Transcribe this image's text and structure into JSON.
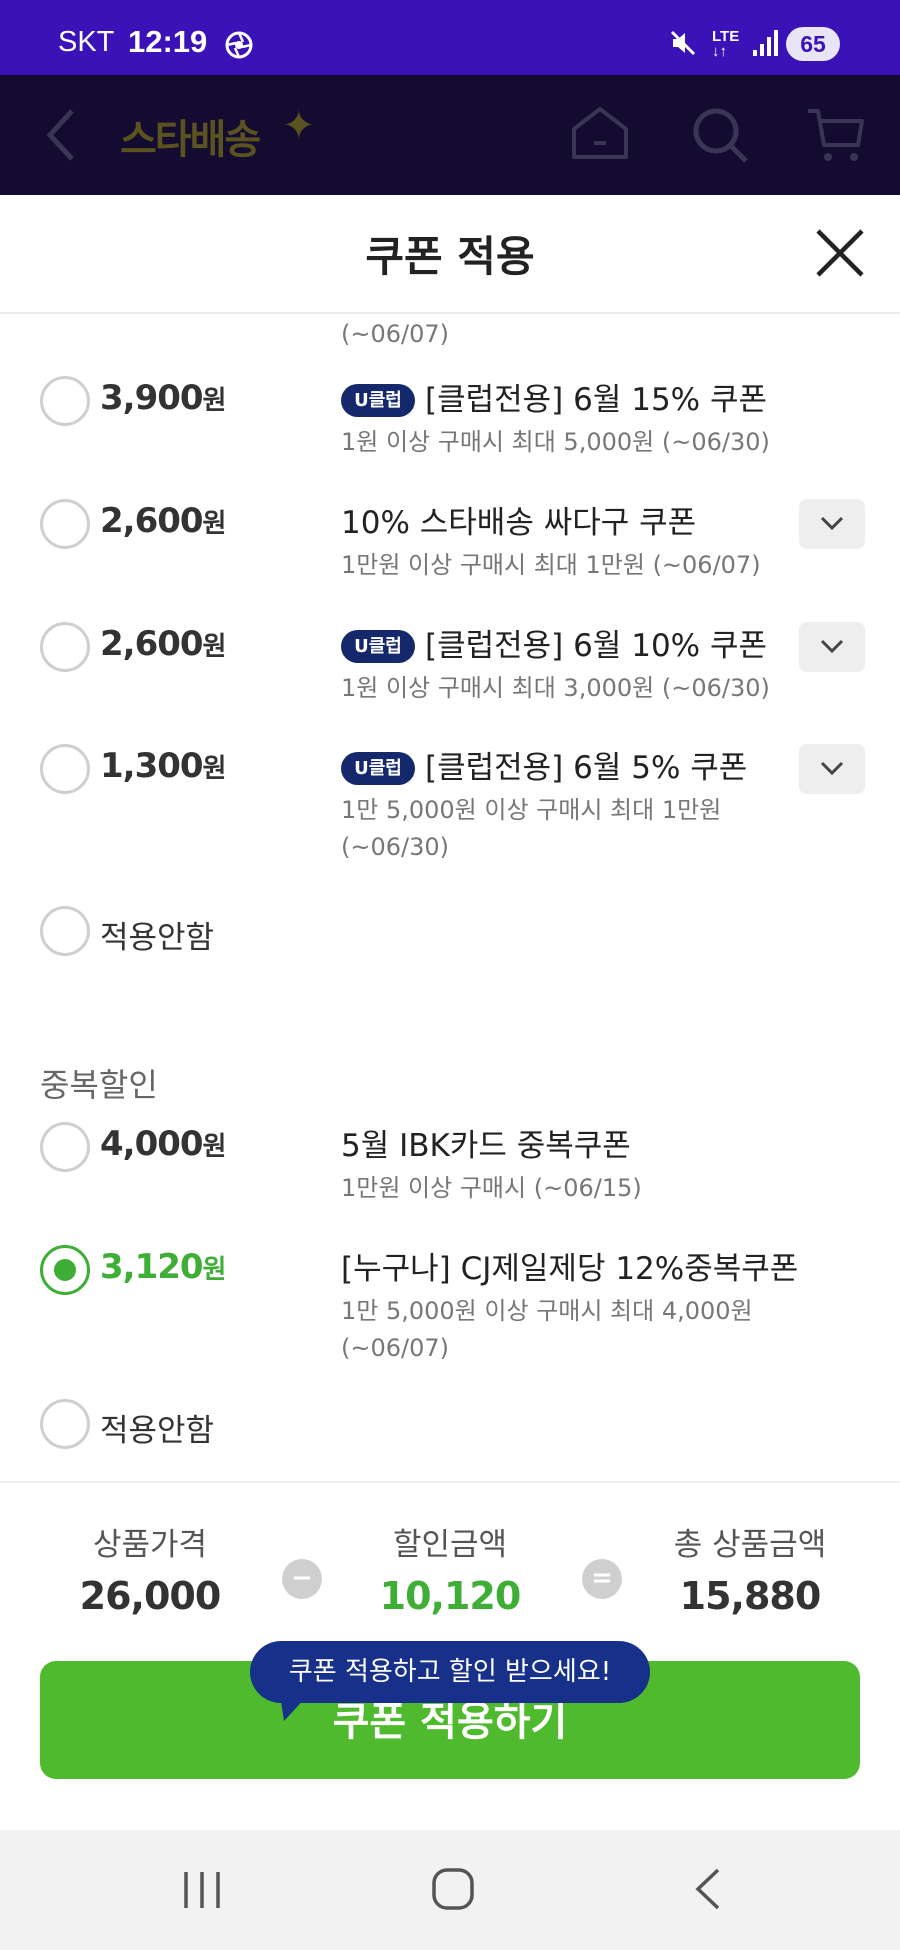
{
  "status_bar": {
    "carrier": "SKT",
    "time": "12:19",
    "network": "LTE",
    "battery": "65",
    "icons": [
      "camera-icon",
      "mute-icon",
      "signal-icon",
      "battery-icon"
    ]
  },
  "app_header": {
    "logo": "스타배송",
    "icons": [
      "back-icon",
      "home-icon",
      "search-icon",
      "cart-icon"
    ]
  },
  "sheet": {
    "title": "쿠폰 적용",
    "close_icon": "close-icon"
  },
  "coupons": {
    "partial_top_desc": "(~06/07)",
    "items": [
      {
        "amount": "3,900",
        "unit": "원",
        "badge": "U클럽",
        "title": "[클럽전용] 6월 15% 쿠폰",
        "desc": "1원 이상 구매시 최대 5,000원 (~06/30)",
        "expandable": false
      },
      {
        "amount": "2,600",
        "unit": "원",
        "badge": "",
        "title": "10% 스타배송 싸다구 쿠폰",
        "desc": "1만원 이상 구매시 최대 1만원 (~06/07)",
        "expandable": true
      },
      {
        "amount": "2,600",
        "unit": "원",
        "badge": "U클럽",
        "title": "[클럽전용] 6월 10% 쿠폰",
        "desc": "1원 이상 구매시 최대 3,000원 (~06/30)",
        "expandable": true
      },
      {
        "amount": "1,300",
        "unit": "원",
        "badge": "U클럽",
        "title": "[클럽전용] 6월 5% 쿠폰",
        "desc_line1": "1만 5,000원 이상 구매시 최대 1만원",
        "desc_line2": "(~06/30)",
        "expandable": true
      }
    ],
    "none_label": "적용안함"
  },
  "duplicate": {
    "section_label": "중복할인",
    "items": [
      {
        "amount": "4,000",
        "unit": "원",
        "title": "5월 IBK카드 중복쿠폰",
        "desc": "1만원 이상 구매시 (~06/15)",
        "selected": false
      },
      {
        "amount": "3,120",
        "unit": "원",
        "title": "[누구나] CJ제일제당 12%중복쿠폰",
        "desc_line1": "1만 5,000원 이상 구매시 최대 4,000원",
        "desc_line2": "(~06/07)",
        "selected": true
      }
    ],
    "none_label": "적용안함"
  },
  "summary": {
    "price_label": "상품가격",
    "price": "26,000",
    "minus": "−",
    "discount_label": "할인금액",
    "discount": "10,120",
    "equals": "=",
    "total_label": "총 상품금액",
    "total": "15,880"
  },
  "tooltip": "쿠폰 적용하고 할인 받으세요!",
  "apply_button": "쿠폰 적용하기",
  "colors": {
    "status_bar": "#3a12b8",
    "accent_green": "#4fba2e",
    "uclub_badge": "#14286b",
    "tooltip": "#173089"
  },
  "nav_bar": {
    "icons": [
      "recent-apps-icon",
      "home-nav-icon",
      "back-nav-icon"
    ]
  }
}
